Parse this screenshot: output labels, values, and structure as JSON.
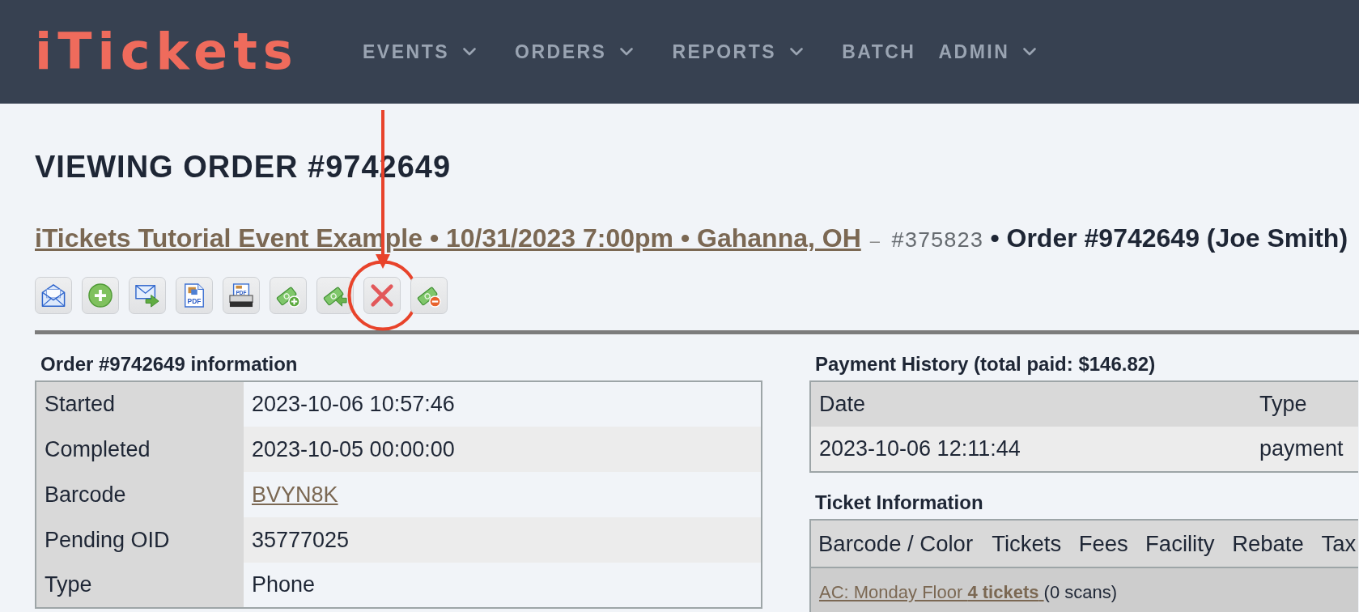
{
  "header": {
    "logo": "iTickets",
    "nav": [
      {
        "label": "EVENTS",
        "has_dropdown": true
      },
      {
        "label": "ORDERS",
        "has_dropdown": true
      },
      {
        "label": "REPORTS",
        "has_dropdown": true
      },
      {
        "label": "BATCH",
        "has_dropdown": false
      },
      {
        "label": "ADMIN",
        "has_dropdown": true
      }
    ]
  },
  "page": {
    "title": "VIEWING ORDER #9742649",
    "event_link": "iTickets Tutorial Event Example • 10/31/2023 7:00pm • Gahanna, OH",
    "separator": "–",
    "event_id": "#375823",
    "order_summary": "• Order #9742649 (Joe Smith)"
  },
  "toolbar": [
    {
      "kind": "envelope",
      "annotated": false
    },
    {
      "kind": "plus",
      "annotated": false
    },
    {
      "kind": "forward",
      "annotated": false
    },
    {
      "kind": "pdf",
      "icon_text": "PDF",
      "annotated": false
    },
    {
      "kind": "printer",
      "icon_text": "PDF",
      "annotated": false
    },
    {
      "kind": "cashplus",
      "annotated": false
    },
    {
      "kind": "cashback",
      "annotated": false
    },
    {
      "kind": "cross",
      "annotated": true
    },
    {
      "kind": "cashminus",
      "annotated": false
    }
  ],
  "order_info": {
    "title": "Order #9742649 information",
    "rows": [
      {
        "label": "Started",
        "value": "2023-10-06 10:57:46",
        "kind": "text"
      },
      {
        "label": "Completed",
        "value": "2023-10-05 00:00:00",
        "kind": "text"
      },
      {
        "label": "Barcode",
        "value": "BVYN8K",
        "kind": "link"
      },
      {
        "label": "Pending OID",
        "value": "35777025",
        "kind": "text"
      },
      {
        "label": "Type",
        "value": "Phone",
        "kind": "text"
      }
    ]
  },
  "payment_history": {
    "title": "Payment History (total paid: $146.82)",
    "columns": [
      "Date",
      "Type"
    ],
    "rows": [
      [
        "2023-10-06 12:11:44",
        "payment"
      ]
    ]
  },
  "ticket_info": {
    "title": "Ticket Information",
    "columns": [
      "Barcode / Color",
      "Tickets",
      "Fees",
      "Facility",
      "Rebate",
      "Tax"
    ],
    "rows": [
      {
        "link": "AC: Monday Floor **4 tickets** ",
        "scans": "(0 scans)"
      }
    ]
  }
}
